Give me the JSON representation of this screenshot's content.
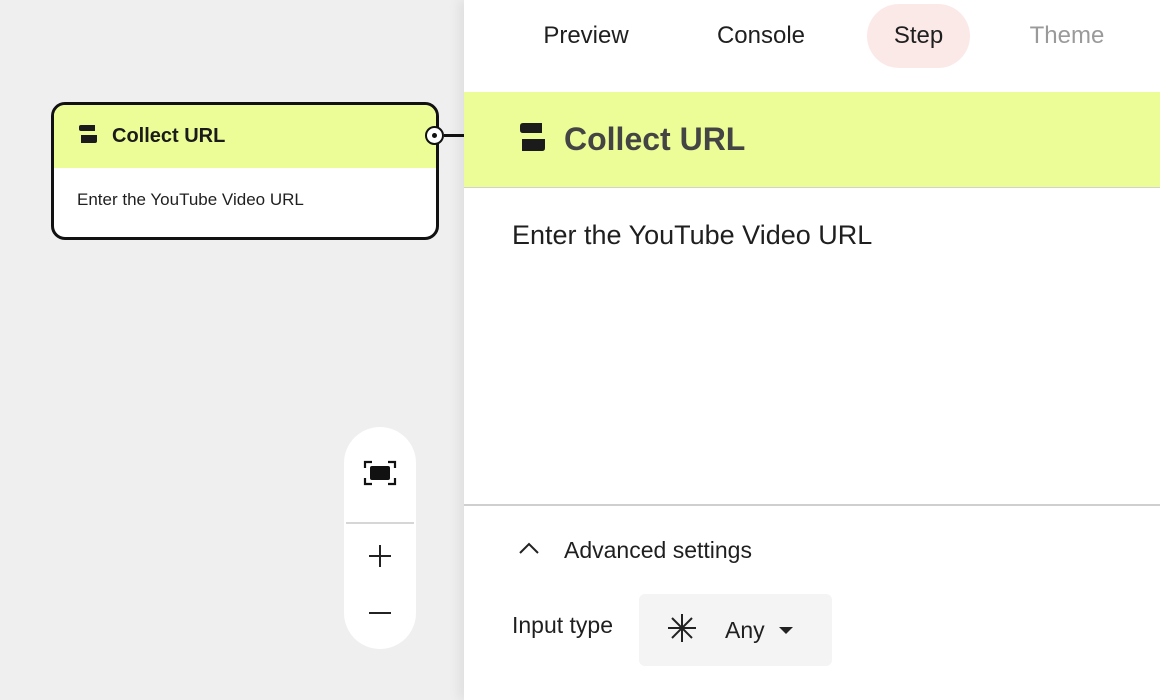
{
  "canvas": {
    "node": {
      "title": "Collect URL",
      "body": "Enter the YouTube Video URL"
    },
    "zoom_controls": {
      "fit_icon": "fit-view-icon",
      "zoom_in_icon": "plus-icon",
      "zoom_out_icon": "minus-icon"
    }
  },
  "panel": {
    "tabs": [
      {
        "label": "Preview"
      },
      {
        "label": "Console"
      },
      {
        "label": "Step",
        "active": true
      },
      {
        "label": "Theme",
        "disabled": true
      }
    ],
    "step": {
      "title": "Collect URL",
      "text": "Enter the YouTube Video URL"
    },
    "advanced": {
      "label": "Advanced settings",
      "input_type_label": "Input type",
      "input_type_value": "Any"
    }
  },
  "colors": {
    "header_accent": "#ecfd97",
    "active_tab_bg": "#fbe9e8"
  }
}
